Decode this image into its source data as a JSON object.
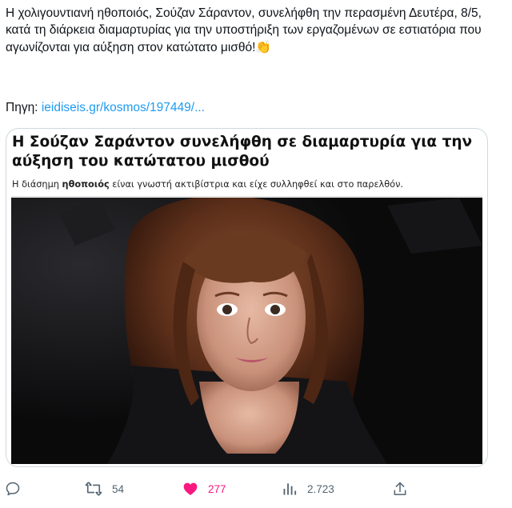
{
  "tweet": {
    "text": "Η χολιγουντιανή ηθοποιός, Σούζαν Σάραντον, συνελήφθη την περασμένη Δευτέρα, 8/5, κατά τη διάρκεια διαμαρτυρίας για την υποστήριξη των εργαζομένων σε εστιατόρια που αγωνίζονται για αύξηση στον κατώτατο μισθό!",
    "emoji": "👏",
    "source_prefix": "Πηγη: ",
    "source_link": "ieidiseis.gr/kosmos/197449/..."
  },
  "card": {
    "title": "Η Σούζαν Σαράντον συνελήφθη σε διαμαρτυρία για την αύξηση του κατώτατου μισθού",
    "subtitle_before": "Η διάσημη ",
    "subtitle_bold": "ηθοποιός",
    "subtitle_after": " είναι γνωστή ακτιβίστρια και είχε συλληφθεί και στο παρελθόν."
  },
  "actions": {
    "reply_icon": "reply-icon",
    "retweet_icon": "retweet-icon",
    "retweet_count": "54",
    "like_icon": "heart-icon",
    "like_count": "277",
    "views_icon": "analytics-icon",
    "views_count": "2.723",
    "share_icon": "share-icon"
  },
  "colors": {
    "link": "#1d9bf0",
    "like": "#f91880",
    "muted": "#536471"
  }
}
